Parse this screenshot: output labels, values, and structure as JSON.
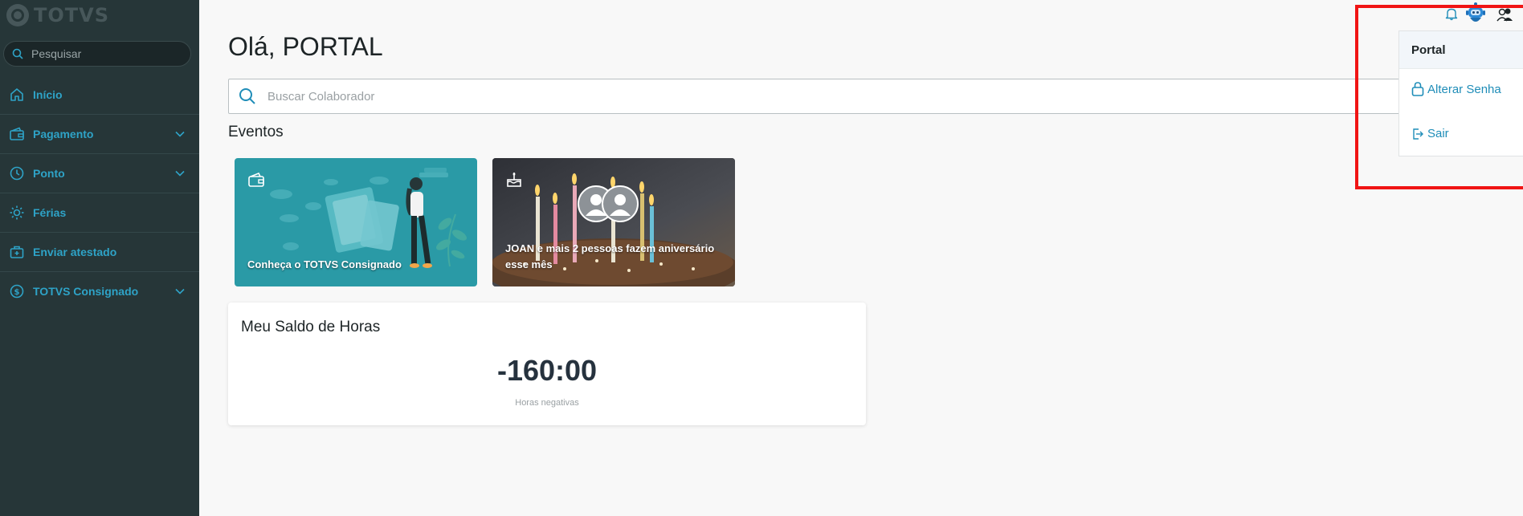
{
  "sidebar": {
    "brand": "TOTVS",
    "search_placeholder": "Pesquisar",
    "items": [
      {
        "label": "Início",
        "icon": "home-icon",
        "expandable": false
      },
      {
        "label": "Pagamento",
        "icon": "wallet-icon",
        "expandable": true
      },
      {
        "label": "Ponto",
        "icon": "clock-icon",
        "expandable": true
      },
      {
        "label": "Férias",
        "icon": "sun-icon",
        "expandable": false
      },
      {
        "label": "Enviar atestado",
        "icon": "medical-bag-icon",
        "expandable": false
      },
      {
        "label": "TOTVS Consignado",
        "icon": "dollar-circle-icon",
        "expandable": true
      }
    ]
  },
  "main": {
    "greeting": "Olá, PORTAL",
    "employee_search_placeholder": "Buscar Colaborador",
    "events_title": "Eventos",
    "events": [
      {
        "caption": "Conheça o TOTVS Consignado",
        "icon": "wallet-icon"
      },
      {
        "caption": "JOAN e mais 2 pessoas fazem aniversário esse mês",
        "icon": "cake-icon"
      }
    ],
    "saldo": {
      "title": "Meu Saldo de Horas",
      "value": "-160:00",
      "label": "Horas negativas"
    }
  },
  "header": {
    "icons": [
      "bell-icon",
      "robot-assistant-icon",
      "user-menu-icon"
    ]
  },
  "user_menu": {
    "title": "Portal",
    "items": [
      {
        "label": "Alterar Senha",
        "icon": "lock-icon"
      },
      {
        "label": "Sair",
        "icon": "logout-icon"
      }
    ]
  },
  "colors": {
    "sidebar_bg": "#263638",
    "accent": "#2ea3c7",
    "link": "#1f8db8",
    "highlight": "#f01414"
  }
}
